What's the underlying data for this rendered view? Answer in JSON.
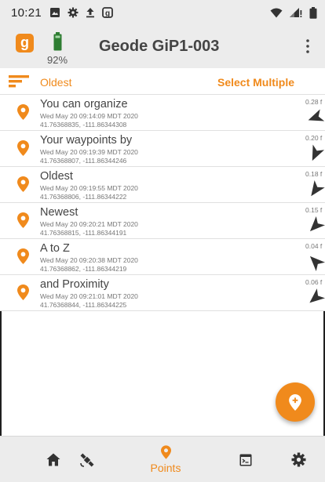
{
  "status_bar": {
    "time": "10:21"
  },
  "app_bar": {
    "logo_letter": "g",
    "battery_percent": "92%",
    "device_name": "Geode GiP1-003"
  },
  "filter": {
    "sort_label": "Oldest",
    "select_multiple_label": "Select Multiple"
  },
  "points": [
    {
      "name": "You can organize",
      "date": "Wed May 20 09:14:09 MDT 2020",
      "coords": "41.76368835, -111.86344308",
      "distance": "0.28 f",
      "bearing_deg": 250
    },
    {
      "name": "Your waypoints by",
      "date": "Wed May 20 09:19:39 MDT 2020",
      "coords": "41.76368807, -111.86344246",
      "distance": "0.20 f",
      "bearing_deg": 205
    },
    {
      "name": "Oldest",
      "date": "Wed May 20 09:19:55 MDT 2020",
      "coords": "41.76368806, -111.86344222",
      "distance": "0.18 f",
      "bearing_deg": 215
    },
    {
      "name": "Newest",
      "date": "Wed May 20 09:20:21 MDT 2020",
      "coords": "41.76368815, -111.86344191",
      "distance": "0.15 f",
      "bearing_deg": 225
    },
    {
      "name": "A to Z",
      "date": "Wed May 20 09:20:38 MDT 2020",
      "coords": "41.76368862, -111.86344219",
      "distance": "0.04 f",
      "bearing_deg": 315
    },
    {
      "name": "and Proximity",
      "date": "Wed May 20 09:21:01 MDT 2020",
      "coords": "41.76368844, -111.86344225",
      "distance": "0.06 f",
      "bearing_deg": 230
    }
  ],
  "bottom_nav": {
    "items": [
      {
        "icon": "home-icon",
        "label": ""
      },
      {
        "icon": "satellite-icon",
        "label": ""
      },
      {
        "icon": "location-pin-icon",
        "label": "Points"
      },
      {
        "icon": "terminal-icon",
        "label": ""
      },
      {
        "icon": "gear-icon",
        "label": ""
      }
    ]
  },
  "colors": {
    "accent": "#f08a1c",
    "battery": "#2e7d32",
    "bar_background": "#ececec",
    "arrow": "#333333"
  }
}
